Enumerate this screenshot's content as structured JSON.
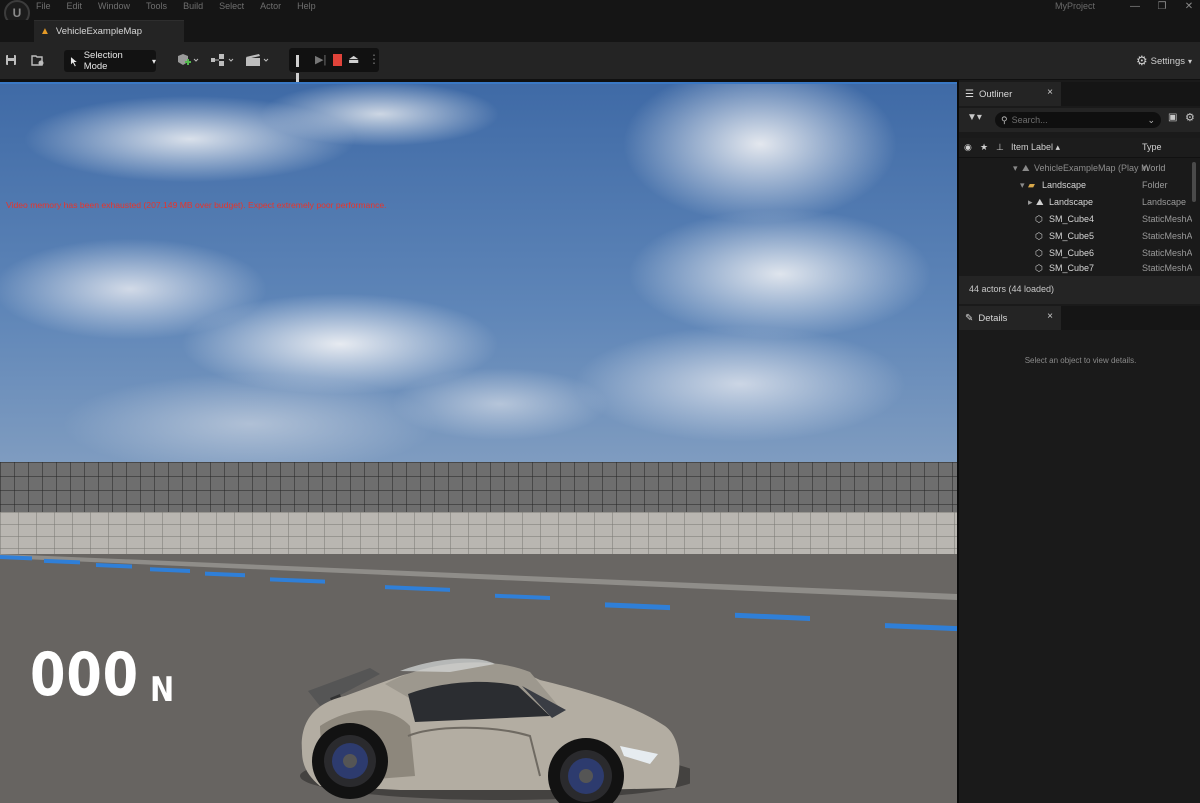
{
  "menu": {
    "items": [
      "File",
      "Edit",
      "Window",
      "Tools",
      "Build",
      "Select",
      "Actor",
      "Help"
    ],
    "project": "MyProject",
    "window_controls": {
      "minimize": "—",
      "maximize": "❐",
      "close": "✕"
    }
  },
  "level_tab": {
    "label": "VehicleExampleMap"
  },
  "toolbar": {
    "selection_mode": "Selection Mode",
    "settings": "Settings"
  },
  "viewport": {
    "warning": "Video memory has been exhausted (207.149 MB over budget). Expect extremely poor performance.",
    "speed": "000",
    "gear": "N"
  },
  "outliner": {
    "tab": "Outliner",
    "search_placeholder": "Search...",
    "col_label": "Item Label ▴",
    "col_type": "Type",
    "rows": [
      {
        "label": "VehicleExampleMap (Play In",
        "type": "World"
      },
      {
        "label": "Landscape",
        "type": "Folder"
      },
      {
        "label": "Landscape",
        "type": "Landscape"
      },
      {
        "label": "SM_Cube4",
        "type": "StaticMeshAc"
      },
      {
        "label": "SM_Cube5",
        "type": "StaticMeshAc"
      },
      {
        "label": "SM_Cube6",
        "type": "StaticMeshAc"
      },
      {
        "label": "SM_Cube7",
        "type": "StaticMeshAc"
      }
    ],
    "footer": "44 actors (44 loaded)"
  },
  "details": {
    "tab": "Details",
    "empty": "Select an object to view details."
  },
  "colors": {
    "accent": "#3a78c4",
    "stop": "#e0433a",
    "warning_text": "#e8342a"
  }
}
